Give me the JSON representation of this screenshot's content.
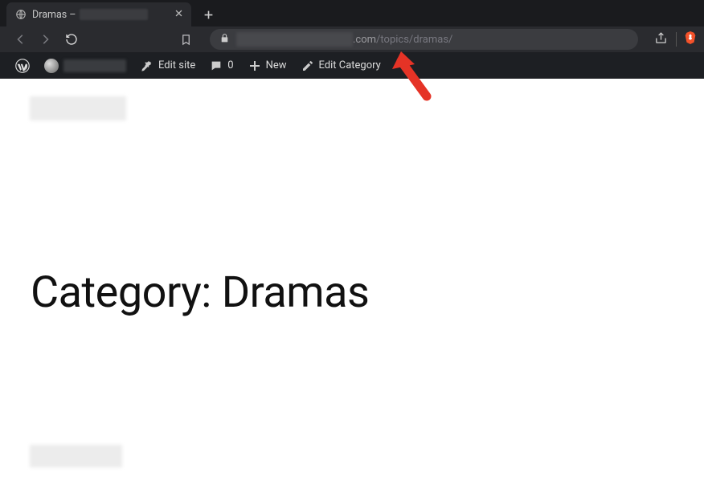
{
  "tab": {
    "title_prefix": "Dramas –"
  },
  "url": {
    "visible_domain_fragment": ".com",
    "path": "/topics/dramas/"
  },
  "wpbar": {
    "edit_site": "Edit site",
    "comments_count": "0",
    "new_label": "New",
    "edit_category": "Edit Category"
  },
  "page": {
    "heading": "Category: Dramas"
  },
  "colors": {
    "chrome_bg": "#2a2b2f",
    "tabstrip_bg": "#1a1b1e",
    "wpbar_bg": "#1d1f23",
    "arrow": "#e53326"
  }
}
